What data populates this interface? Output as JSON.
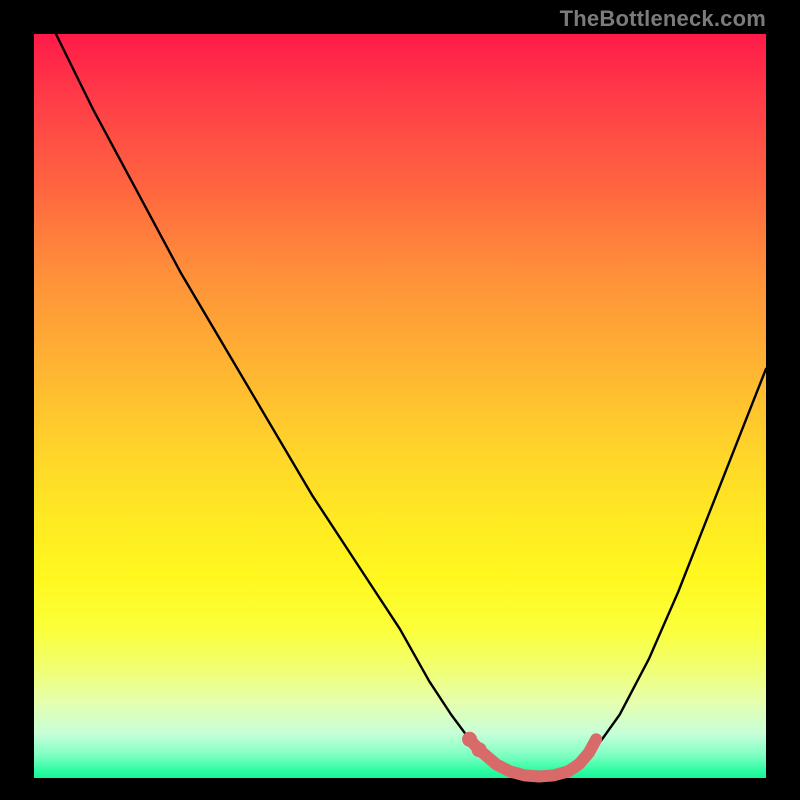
{
  "watermark": "TheBottleneck.com",
  "colors": {
    "background": "#000000",
    "curve": "#000000",
    "highlight": "#d86a6a",
    "gradient_top": "#ff1a49",
    "gradient_bottom": "#17f59b"
  },
  "chart_data": {
    "type": "line",
    "title": "",
    "xlabel": "",
    "ylabel": "",
    "xlim": [
      0,
      100
    ],
    "ylim": [
      0,
      100
    ],
    "grid": false,
    "legend": false,
    "series": [
      {
        "name": "left-branch",
        "x": [
          3,
          8,
          14,
          20,
          26,
          32,
          38,
          44,
          50,
          54,
          57,
          59.5,
          61.5,
          63,
          64
        ],
        "y": [
          100,
          90,
          79,
          68,
          58,
          48,
          38,
          29,
          20,
          13,
          8.5,
          5.2,
          3.2,
          1.6,
          0.8
        ]
      },
      {
        "name": "valley-floor",
        "x": [
          64,
          66,
          68,
          70,
          72,
          73.5
        ],
        "y": [
          0.8,
          0.3,
          0.15,
          0.15,
          0.3,
          0.8
        ]
      },
      {
        "name": "right-branch",
        "x": [
          73.5,
          76,
          80,
          84,
          88,
          92,
          96,
          100
        ],
        "y": [
          0.8,
          3,
          8.5,
          16,
          25,
          35,
          45,
          55
        ]
      }
    ],
    "annotations": [
      {
        "name": "highlight-segment",
        "description": "thick salmon overlay near curve minimum",
        "x": [
          59.5,
          60.8,
          62,
          63.2,
          65,
          67,
          69,
          71,
          73,
          74.5,
          75.8,
          76.8
        ],
        "y": [
          5.2,
          3.8,
          2.8,
          1.8,
          0.9,
          0.35,
          0.2,
          0.35,
          0.9,
          1.9,
          3.4,
          5.2
        ]
      },
      {
        "name": "highlight-dot-1",
        "x": 59.5,
        "y": 5.2
      },
      {
        "name": "highlight-dot-2",
        "x": 60.8,
        "y": 3.8
      }
    ]
  }
}
